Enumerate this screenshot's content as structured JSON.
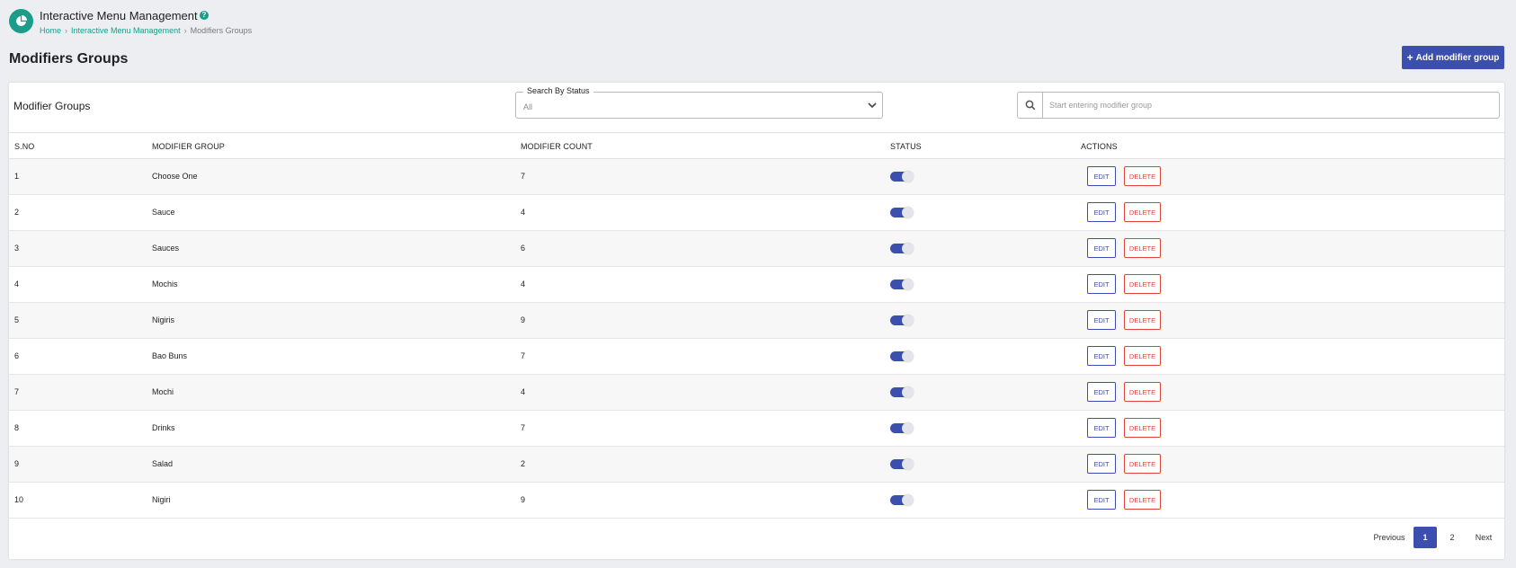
{
  "header": {
    "app_title": "Interactive Menu Management",
    "help_icon": "?",
    "breadcrumb": [
      {
        "label": "Home"
      },
      {
        "label": "Interactive Menu Management"
      },
      {
        "label": "Modifiers Groups"
      }
    ],
    "separator": "›"
  },
  "page": {
    "title": "Modifiers Groups",
    "add_button_label": "Add modifier group",
    "add_button_icon": "+"
  },
  "card": {
    "title": "Modifier Groups",
    "status_filter": {
      "legend": "Search By Status",
      "value": "All"
    },
    "search": {
      "placeholder": "Start entering modifier group"
    }
  },
  "table": {
    "columns": [
      "S.NO",
      "MODIFIER GROUP",
      "MODIFIER COUNT",
      "STATUS",
      "ACTIONS"
    ],
    "edit_label": "EDIT",
    "delete_label": "DELETE",
    "rows": [
      {
        "sno": "1",
        "group": "Choose One",
        "count": "7",
        "active": true
      },
      {
        "sno": "2",
        "group": "Sauce",
        "count": "4",
        "active": true
      },
      {
        "sno": "3",
        "group": "Sauces",
        "count": "6",
        "active": true
      },
      {
        "sno": "4",
        "group": "Mochis",
        "count": "4",
        "active": true
      },
      {
        "sno": "5",
        "group": "Nigiris",
        "count": "9",
        "active": true
      },
      {
        "sno": "6",
        "group": "Bao Buns",
        "count": "7",
        "active": true
      },
      {
        "sno": "7",
        "group": "Mochi",
        "count": "4",
        "active": true
      },
      {
        "sno": "8",
        "group": "Drinks",
        "count": "7",
        "active": true
      },
      {
        "sno": "9",
        "group": "Salad",
        "count": "2",
        "active": true
      },
      {
        "sno": "10",
        "group": "Nigiri",
        "count": "9",
        "active": true
      }
    ]
  },
  "pagination": {
    "previous": "Previous",
    "pages": [
      "1",
      "2"
    ],
    "current": "1",
    "next": "Next"
  },
  "colors": {
    "primary": "#3d4fae",
    "teal": "#1b9d8a",
    "danger": "#d9473b"
  }
}
